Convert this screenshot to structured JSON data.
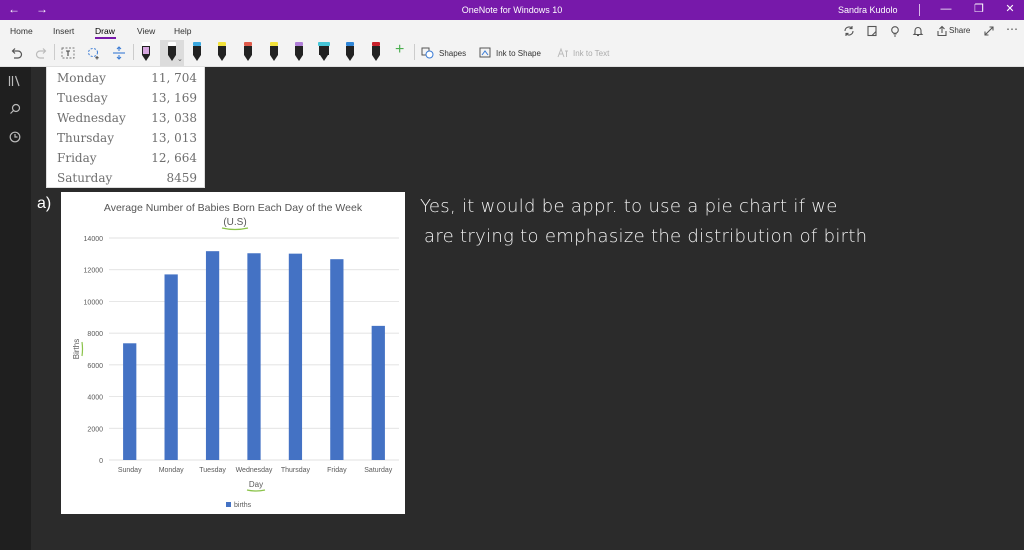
{
  "titlebar": {
    "back_glyph": "←",
    "forward_glyph": "→",
    "title": "OneNote for Windows 10",
    "user": "Sandra Kudolo",
    "minimize_glyph": "—",
    "restore_glyph": "❐",
    "close_glyph": "✕",
    "color": "#7719aa"
  },
  "ribbon": {
    "tabs": [
      {
        "label": "Home"
      },
      {
        "label": "Insert"
      },
      {
        "label": "Draw"
      },
      {
        "label": "View"
      },
      {
        "label": "Help"
      }
    ],
    "active_tab": "Draw",
    "share_label": "Share",
    "shapes_label": "Shapes",
    "ink_to_shape_label": "Ink to Shape",
    "ink_to_text_label": "Ink to Text",
    "add_pen_glyph": "+",
    "pens": [
      {
        "color": "#e8c6ec"
      },
      {
        "color": "#ffffff"
      },
      {
        "color": "#3aa8e0"
      },
      {
        "color": "#f2e23b"
      },
      {
        "color": "#e05a4a"
      },
      {
        "color": "#f2e23b"
      },
      {
        "color": "#b07ed8"
      },
      {
        "color": "#46c6d8"
      },
      {
        "color": "#2f86d8"
      },
      {
        "color": "#c8202a"
      }
    ]
  },
  "table": {
    "rows": [
      {
        "day": "Monday",
        "value": "11, 704"
      },
      {
        "day": "Tuesday",
        "value": "13, 169"
      },
      {
        "day": "Wednesday",
        "value": "13, 038"
      },
      {
        "day": "Thursday",
        "value": "13, 013"
      },
      {
        "day": "Friday",
        "value": "12, 664"
      },
      {
        "day": "Saturday",
        "value": "8459"
      }
    ]
  },
  "question_label": "a)",
  "handwriting": {
    "line1": "Yes, it would be appr. to use a pie chart if we",
    "line2": "are trying to emphasize the distribution of birth"
  },
  "chart_data": {
    "type": "bar",
    "title": "Average Number of Babies Born Each Day of the Week",
    "subtitle": "(U.S)",
    "xlabel": "Day",
    "ylabel": "Births",
    "categories": [
      "Sunday",
      "Monday",
      "Tuesday",
      "Wednesday",
      "Thursday",
      "Friday",
      "Saturday"
    ],
    "series": [
      {
        "name": "births",
        "values": [
          7360,
          11704,
          13169,
          13038,
          13013,
          12664,
          8459
        ],
        "color": "#4472c4"
      }
    ],
    "ylim": [
      0,
      14000
    ],
    "yticks": [
      0,
      2000,
      4000,
      6000,
      8000,
      10000,
      12000,
      14000
    ],
    "grid": true,
    "legend": "bottom"
  }
}
